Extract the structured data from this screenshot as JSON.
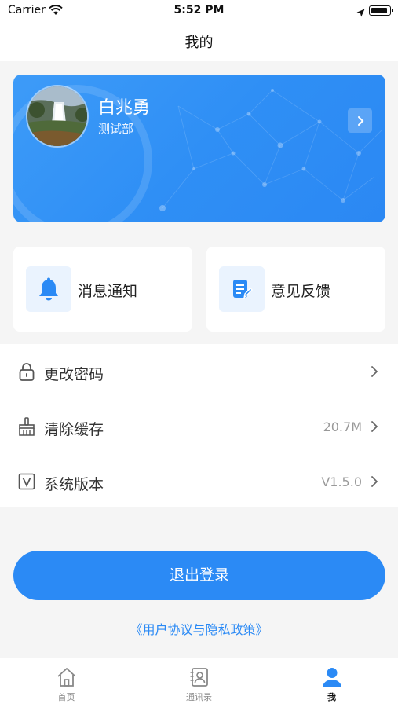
{
  "status_bar": {
    "carrier": "Carrier",
    "time": "5:52 PM"
  },
  "nav": {
    "title": "我的"
  },
  "profile": {
    "name": "白兆勇",
    "department": "测试部"
  },
  "quick_actions": [
    {
      "label": "消息通知",
      "icon": "bell-icon"
    },
    {
      "label": "意见反馈",
      "icon": "feedback-edit-icon"
    }
  ],
  "menu": [
    {
      "label": "更改密码",
      "value": "",
      "icon": "lock-icon"
    },
    {
      "label": "清除缓存",
      "value": "20.7M",
      "icon": "broom-icon"
    },
    {
      "label": "系统版本",
      "value": "V1.5.0",
      "icon": "version-icon"
    }
  ],
  "logout_label": "退出登录",
  "policy_link": "《用户协议与隐私政策》",
  "tabs": [
    {
      "label": "首页",
      "icon": "home-icon",
      "active": false
    },
    {
      "label": "通讯录",
      "icon": "contacts-icon",
      "active": false
    },
    {
      "label": "我",
      "icon": "person-icon",
      "active": true
    }
  ],
  "colors": {
    "accent": "#2b8af5",
    "card_gradient_start": "#3d9bf8",
    "icon_bg": "#eaf3fe"
  }
}
